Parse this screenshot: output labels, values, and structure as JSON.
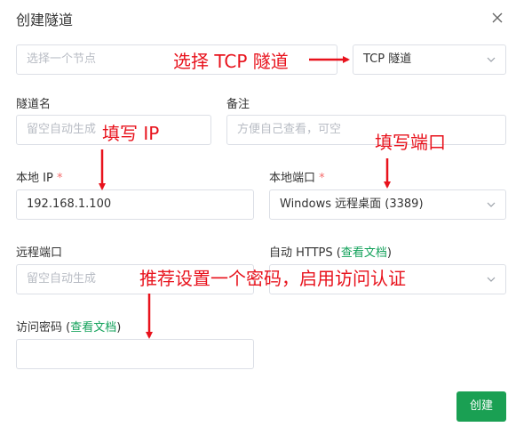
{
  "dialog": {
    "title": "创建隧道",
    "close_icon": "close-icon"
  },
  "node_select": {
    "placeholder": "选择一个节点"
  },
  "type_select": {
    "value": "TCP 隧道"
  },
  "tunnel_name": {
    "label": "隧道名",
    "placeholder": "留空自动生成"
  },
  "note": {
    "label": "备注",
    "placeholder": "方便自己查看，可空"
  },
  "local_ip": {
    "label": "本地 IP",
    "required_mark": "*",
    "value": "192.168.1.100"
  },
  "local_port": {
    "label": "本地端口",
    "required_mark": "*",
    "value": "Windows 远程桌面 (3389)"
  },
  "remote_port": {
    "label": "远程端口",
    "placeholder": "留空自动生成"
  },
  "auto_https": {
    "label": "自动 HTTPS",
    "paren_open": "(",
    "doc_link": "查看文档",
    "paren_close": ")"
  },
  "access_password": {
    "label": "访问密码",
    "paren_open": "(",
    "doc_link": "查看文档",
    "paren_close": ")",
    "value": ""
  },
  "create_button": {
    "label": "创建"
  },
  "annotations": {
    "choose_tcp": "选择 TCP 隧道",
    "fill_ip": "填写 IP",
    "fill_port": "填写端口",
    "recommend_password": "推荐设置一个密码，启用访问认证"
  },
  "colors": {
    "accent": "#1aa053",
    "link": "#12a15a",
    "annotation": "#e8121c",
    "required": "#f56c6c"
  }
}
